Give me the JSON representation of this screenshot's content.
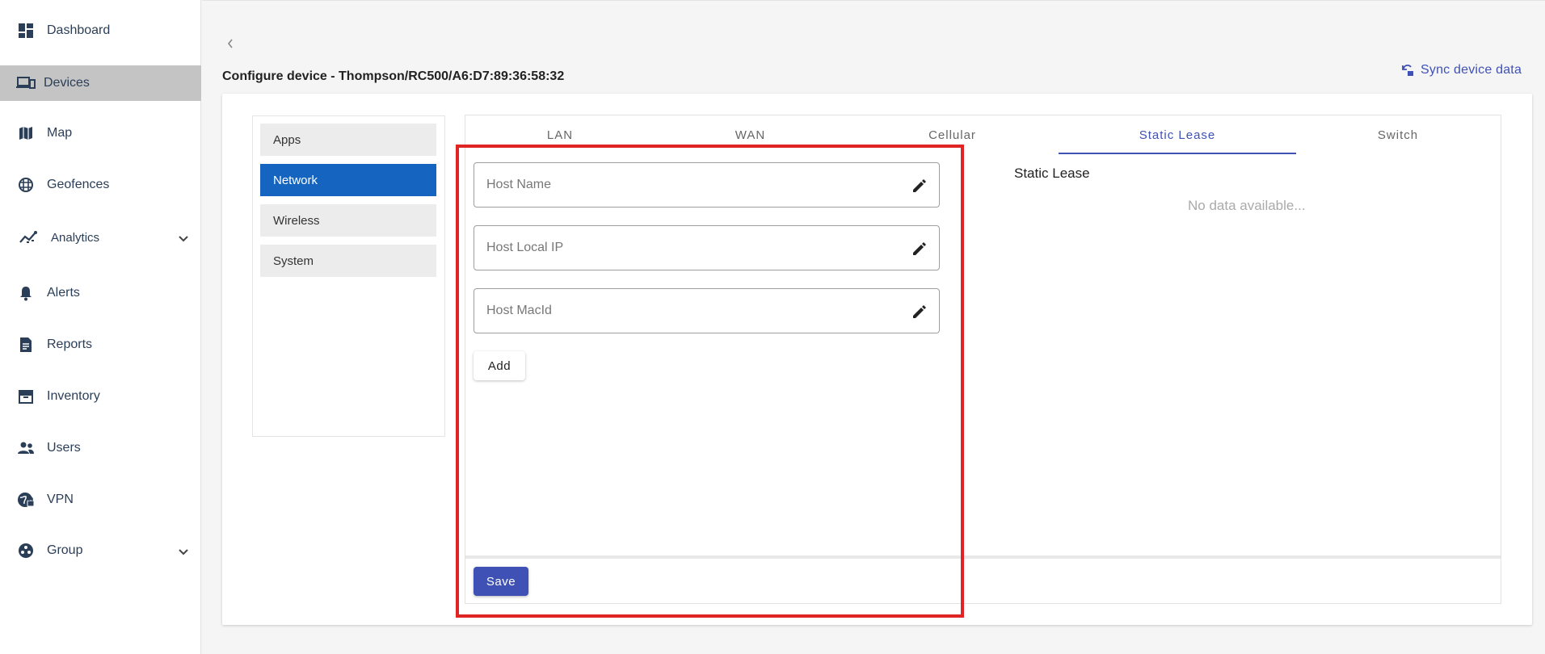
{
  "sidebar": {
    "items": [
      {
        "label": "Dashboard",
        "icon": "dashboard-icon"
      },
      {
        "label": "Devices",
        "icon": "devices-icon",
        "active": true
      },
      {
        "label": "Map",
        "icon": "map-icon"
      },
      {
        "label": "Geofences",
        "icon": "grid-globe-icon"
      },
      {
        "label": "Analytics",
        "icon": "analytics-icon",
        "expandable": true
      },
      {
        "label": "Alerts",
        "icon": "bell-icon"
      },
      {
        "label": "Reports",
        "icon": "report-icon"
      },
      {
        "label": "Inventory",
        "icon": "archive-icon"
      },
      {
        "label": "Users",
        "icon": "users-icon"
      },
      {
        "label": "VPN",
        "icon": "vpn-globe-icon"
      },
      {
        "label": "Group",
        "icon": "group-icon",
        "expandable": true
      }
    ]
  },
  "header": {
    "title": "Configure device - Thompson/RC500/A6:D7:89:36:58:32",
    "sync_label": "Sync device data"
  },
  "config_menu": {
    "items": [
      {
        "label": "Apps"
      },
      {
        "label": "Network",
        "active": true
      },
      {
        "label": "Wireless"
      },
      {
        "label": "System"
      }
    ]
  },
  "tabs": [
    {
      "label": "LAN"
    },
    {
      "label": "WAN"
    },
    {
      "label": "Cellular"
    },
    {
      "label": "Static Lease",
      "active": true
    },
    {
      "label": "Switch"
    }
  ],
  "form": {
    "host_name_placeholder": "Host Name",
    "host_ip_placeholder": "Host Local IP",
    "host_mac_placeholder": "Host MacId",
    "add_label": "Add",
    "save_label": "Save"
  },
  "static_lease": {
    "title": "Static Lease",
    "empty_text": "No data available..."
  },
  "colors": {
    "accent": "#3f51b5",
    "active_menu": "#1565c0",
    "highlight": "#e02424"
  }
}
